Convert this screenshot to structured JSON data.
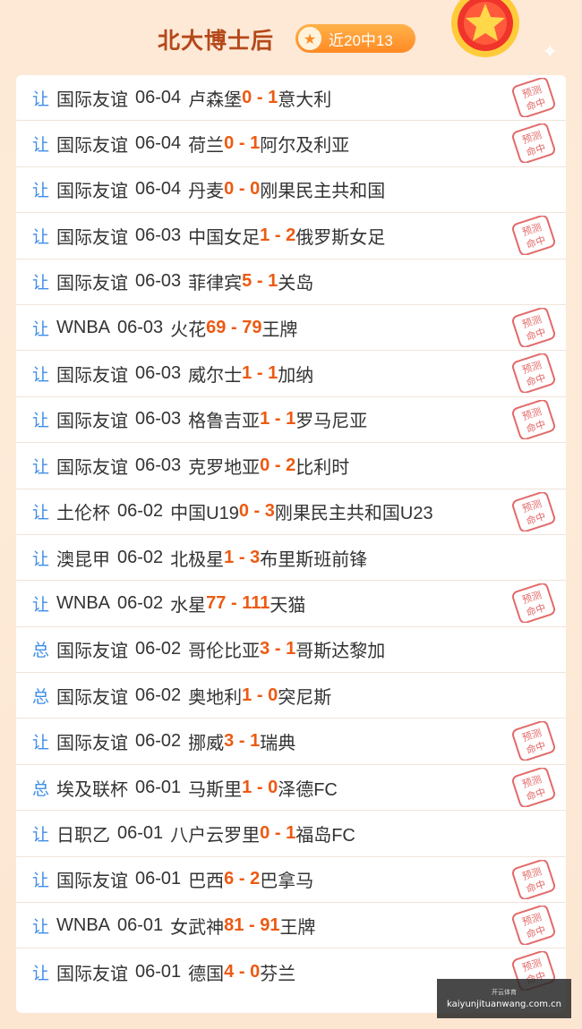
{
  "header": {
    "title": "北大博士后",
    "badge_text": "近20中13",
    "badge_icon": "star-icon",
    "medal_icon": "gold-medal-star-icon"
  },
  "colors": {
    "tag": "#3f8ee8",
    "score": "#ec5a12",
    "title": "#b5481a",
    "stamp": "#e36a6a"
  },
  "stamp_text": [
    "预测",
    "命中"
  ],
  "rows": [
    {
      "tag": "让",
      "league": "国际友谊",
      "date": "06-04",
      "home": "卢森堡",
      "score": "0 - 1",
      "away": "意大利",
      "hit": true
    },
    {
      "tag": "让",
      "league": "国际友谊",
      "date": "06-04",
      "home": "荷兰",
      "score": "0 - 1",
      "away": "阿尔及利亚",
      "hit": true
    },
    {
      "tag": "让",
      "league": "国际友谊",
      "date": "06-04",
      "home": "丹麦",
      "score": "0 - 0",
      "away": "刚果民主共和国",
      "hit": false
    },
    {
      "tag": "让",
      "league": "国际友谊",
      "date": "06-03",
      "home": "中国女足",
      "score": "1 - 2",
      "away": "俄罗斯女足",
      "hit": true
    },
    {
      "tag": "让",
      "league": "国际友谊",
      "date": "06-03",
      "home": "菲律宾",
      "score": "5 - 1",
      "away": "关岛",
      "hit": false
    },
    {
      "tag": "让",
      "league": "WNBA",
      "date": "06-03",
      "home": "火花",
      "score": "69 - 79",
      "away": "王牌",
      "hit": true
    },
    {
      "tag": "让",
      "league": "国际友谊",
      "date": "06-03",
      "home": "威尔士",
      "score": "1 - 1",
      "away": "加纳",
      "hit": true
    },
    {
      "tag": "让",
      "league": "国际友谊",
      "date": "06-03",
      "home": "格鲁吉亚",
      "score": "1 - 1",
      "away": "罗马尼亚",
      "hit": true
    },
    {
      "tag": "让",
      "league": "国际友谊",
      "date": "06-03",
      "home": "克罗地亚",
      "score": "0 - 2",
      "away": "比利时",
      "hit": false
    },
    {
      "tag": "让",
      "league": "土伦杯",
      "date": "06-02",
      "home": "中国U19",
      "score": "0 - 3",
      "away": "刚果民主共和国U23",
      "hit": true
    },
    {
      "tag": "让",
      "league": "澳昆甲",
      "date": "06-02",
      "home": "北极星",
      "score": "1 - 3",
      "away": "布里斯班前锋",
      "hit": false
    },
    {
      "tag": "让",
      "league": "WNBA",
      "date": "06-02",
      "home": "水星",
      "score": "77 - 111",
      "away": "天猫",
      "hit": true
    },
    {
      "tag": "总",
      "league": "国际友谊",
      "date": "06-02",
      "home": "哥伦比亚",
      "score": "3 - 1",
      "away": "哥斯达黎加",
      "hit": false
    },
    {
      "tag": "总",
      "league": "国际友谊",
      "date": "06-02",
      "home": "奥地利",
      "score": "1 - 0",
      "away": "突尼斯",
      "hit": false
    },
    {
      "tag": "让",
      "league": "国际友谊",
      "date": "06-02",
      "home": "挪威",
      "score": "3 - 1",
      "away": "瑞典",
      "hit": true
    },
    {
      "tag": "总",
      "league": "埃及联杯",
      "date": "06-01",
      "home": "马斯里",
      "score": "1 - 0",
      "away": "泽德FC",
      "hit": true
    },
    {
      "tag": "让",
      "league": "日职乙",
      "date": "06-01",
      "home": "八户云罗里",
      "score": "0 - 1",
      "away": "福岛FC",
      "hit": false
    },
    {
      "tag": "让",
      "league": "国际友谊",
      "date": "06-01",
      "home": "巴西",
      "score": "6 - 2",
      "away": "巴拿马",
      "hit": true
    },
    {
      "tag": "让",
      "league": "WNBA",
      "date": "06-01",
      "home": "女武神",
      "score": "81 - 91",
      "away": "王牌",
      "hit": true
    },
    {
      "tag": "让",
      "league": "国际友谊",
      "date": "06-01",
      "home": "德国",
      "score": "4 - 0",
      "away": "芬兰",
      "hit": true
    }
  ],
  "watermark": {
    "line1": "开云体育",
    "line2": "kaiyunjituanwang.com.cn"
  }
}
